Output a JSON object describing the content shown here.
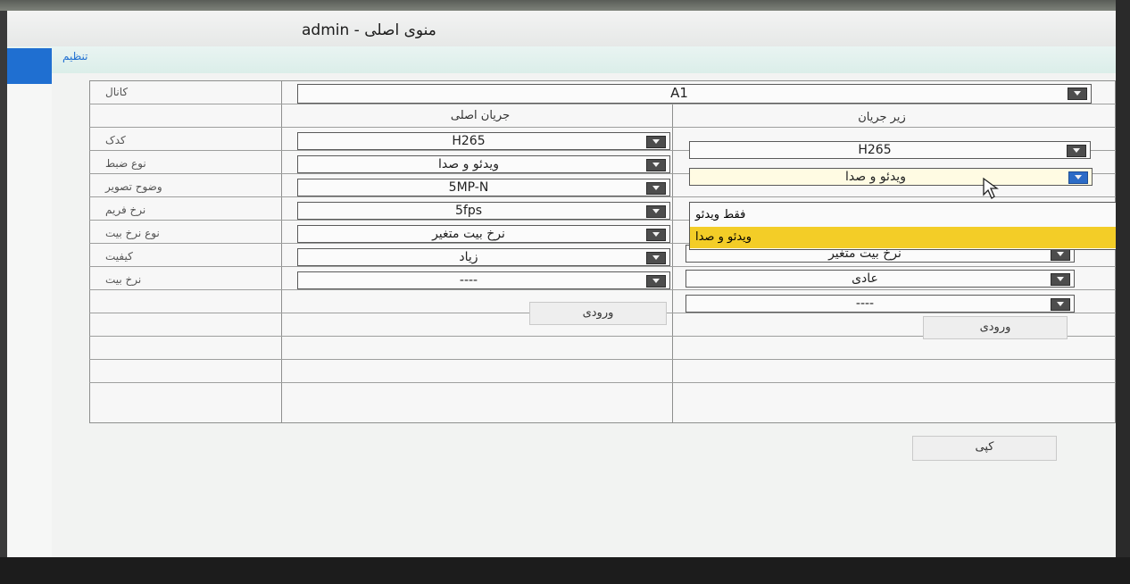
{
  "window": {
    "title": "admin - منوی اصلی"
  },
  "nav": {
    "tab_setup": "تنظیم"
  },
  "table": {
    "channel_label": "کانال",
    "channel_value": "A1",
    "main_stream_header": "جریان اصلی",
    "sub_stream_header": "زیر جریان",
    "row_labels": [
      "کدک",
      "نوع ضبط",
      "وضوح تصویر",
      "نرخ فریم",
      "نوع نرخ بیت",
      "کیفیت",
      "نرخ بیت"
    ],
    "main_values": [
      "H265",
      "ویدئو و صدا",
      "5MP-N",
      "5fps",
      "نرخ بیت متغیر",
      "زیاد",
      "----"
    ],
    "sub_values": [
      "H265",
      "ویدئو و صدا",
      "نرخ بیت متغیر",
      "عادی",
      "----"
    ],
    "main_input_button": "ورودی",
    "sub_input_button": "ورودی"
  },
  "dropdown": {
    "options": [
      "فقط ویدئو",
      "ویدئو و صدا"
    ],
    "selected_index": 1
  },
  "copy_button": "کپی",
  "colors": {
    "accent": "#1f6fd1",
    "highlight": "#f3cd27"
  },
  "icons": {
    "cursor": "mouse-pointer-icon",
    "dropdown_arrow": "chevron-down-icon"
  }
}
